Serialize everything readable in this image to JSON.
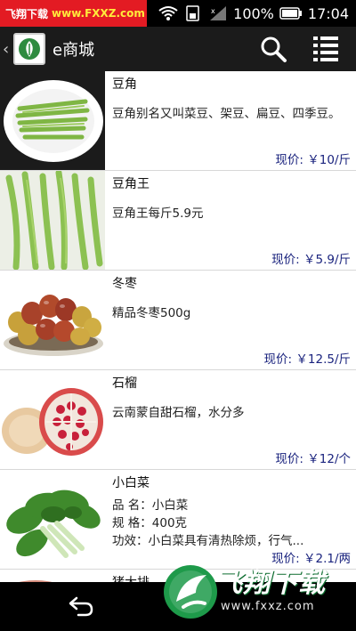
{
  "status_bar": {
    "watermark_site": "飞翔下载",
    "watermark_url": "www.FXXZ.com",
    "battery_percent": "100%",
    "time": "17:04"
  },
  "app_bar": {
    "title": "e商城",
    "back_glyph": "‹",
    "icons": [
      "app-logo",
      "search-icon",
      "menu-list-icon"
    ]
  },
  "products": [
    {
      "name": "豆角",
      "desc": "豆角别名又叫菜豆、架豆、扁豆、四季豆。",
      "price": "现价: ￥10/斤",
      "image": "green-beans-plate"
    },
    {
      "name": "豆角王",
      "desc": "豆角王每斤5.9元",
      "price": "现价: ￥5.9/斤",
      "image": "long-beans"
    },
    {
      "name": "冬枣",
      "desc": "精品冬枣500g",
      "price": "现价: ￥12.5/斤",
      "image": "jujubes"
    },
    {
      "name": "石榴",
      "desc": "云南蒙自甜石榴，水分多",
      "price": "现价: ￥12/个",
      "image": "pomegranate"
    },
    {
      "name": "小白菜",
      "desc_lines": [
        "品  名：小白菜",
        "规  格：400克",
        "功效：小白菜具有清热除烦，行气..."
      ],
      "price": "现价: ￥2.1/两",
      "image": "bok-choy"
    },
    {
      "name": "猪大排",
      "image": "pork-chop"
    }
  ],
  "nav_bar": {
    "icons": [
      "back-icon"
    ]
  },
  "brand_watermark": {
    "name": "飞翔下载",
    "url": "www.fxxz.com"
  },
  "colors": {
    "price": "#1a237e",
    "app_bar": "#1b1b1b",
    "watermark_red": "#e31b23",
    "brand_green": "#1e9a4a"
  }
}
